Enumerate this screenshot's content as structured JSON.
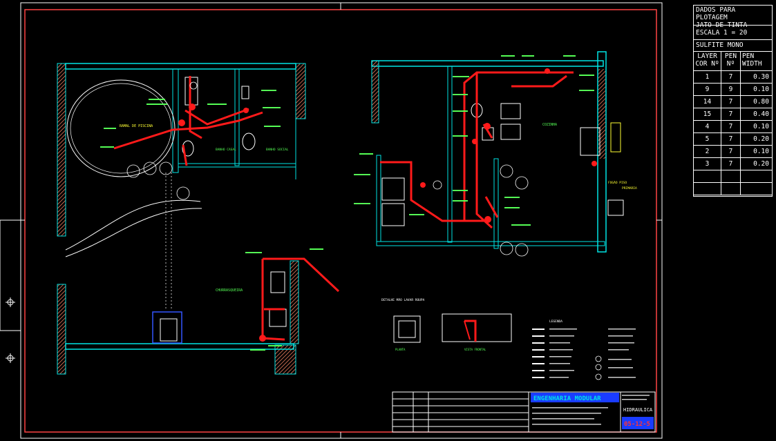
{
  "plot_settings": {
    "title_line1": "DADOS PARA PLOTAGEM",
    "title_line2": "JATO DE TINTA",
    "scale": "ESCALA 1 = 20",
    "paper": "SULFITE MONO",
    "col_layer": "LAYER COR Nº",
    "col_pen": "PEN Nº",
    "col_width": "PEN WIDTH",
    "rows": [
      {
        "layer": "1",
        "pen": "7",
        "width": "0.30"
      },
      {
        "layer": "9",
        "pen": "9",
        "width": "0.10"
      },
      {
        "layer": "14",
        "pen": "7",
        "width": "0.80"
      },
      {
        "layer": "15",
        "pen": "7",
        "width": "0.40"
      },
      {
        "layer": "4",
        "pen": "7",
        "width": "0.10"
      },
      {
        "layer": "5",
        "pen": "7",
        "width": "0.20"
      },
      {
        "layer": "2",
        "pen": "7",
        "width": "0.10"
      },
      {
        "layer": "3",
        "pen": "7",
        "width": "0.20"
      }
    ]
  },
  "drawing": {
    "room_labels": {
      "banho_casal": "BANHO CASAL",
      "banho_social": "BANHO SOCIAL",
      "cozinha": "COZINHA",
      "churrasqueira": "CHURRASQUEIRA",
      "detalhe_lavanderia": "DETALHE MÃO LAVAR ROUPA",
      "legenda": "LEGENDA",
      "planta": "PLANTA",
      "vista_frontal": "VISTA FRONTAL",
      "fogao_piso": "FOGÃO PISO",
      "primaria": "PRIMARIA"
    },
    "title_block": {
      "company": "ENGENHARIA MODULAR",
      "discipline": "HIDRAULICA",
      "sheet_code": "05-12-5"
    }
  },
  "colors": {
    "background": "#000000",
    "frame": "#ffffff",
    "walls": "#00e5e5",
    "pipes": "#ff1a1a",
    "hatch": "#ff8a6a",
    "annotations": "#55ff55",
    "highlight": "#ffff33",
    "title_fill": "#1a3cff"
  }
}
